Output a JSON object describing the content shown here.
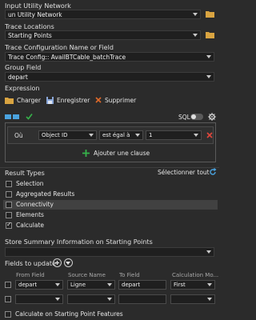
{
  "input_network": {
    "label": "Input Utility Network",
    "value": "un Utility Network"
  },
  "trace_locations": {
    "label": "Trace Locations",
    "value": "Starting Points"
  },
  "trace_config": {
    "label": "Trace Configuration Name or Field",
    "value": "Trace Config:: AvailBTCable_batchTrace"
  },
  "group_field": {
    "label": "Group Field",
    "value": "depart"
  },
  "expression": {
    "label": "Expression",
    "load": "Charger",
    "save": "Enregistrer",
    "delete": "Supprimer",
    "sql_label": "SQL",
    "clause": {
      "prefix": "Où",
      "field": "Object ID",
      "operator": "est égal à",
      "value": "1"
    },
    "add_clause": "Ajouter une clause"
  },
  "result_types": {
    "label": "Result Types",
    "select_all": "Sélectionner tout",
    "items": [
      {
        "label": "Selection",
        "checked": false
      },
      {
        "label": "Aggregated Results",
        "checked": false
      },
      {
        "label": "Connectivity",
        "checked": false
      },
      {
        "label": "Elements",
        "checked": false
      },
      {
        "label": "Calculate",
        "checked": true
      }
    ]
  },
  "summary": {
    "label": "Store Summary Information on Starting Points",
    "value": ""
  },
  "fields_to_update": {
    "label": "Fields to update",
    "headers": [
      "From Field",
      "Source Name",
      "To Field",
      "Calculation Mo..."
    ],
    "rows": [
      [
        "depart",
        "Ligne",
        "depart",
        "First"
      ],
      [
        "",
        "",
        "",
        ""
      ]
    ]
  },
  "calc_starting": {
    "label": "Calculate on Starting Point Features",
    "checked": false
  },
  "colors": {
    "background": "#2b2b2b",
    "accent_green": "#36b24a",
    "accent_red": "#e0473c",
    "accent_blue": "#4aa3df",
    "highlight": "#414141"
  }
}
